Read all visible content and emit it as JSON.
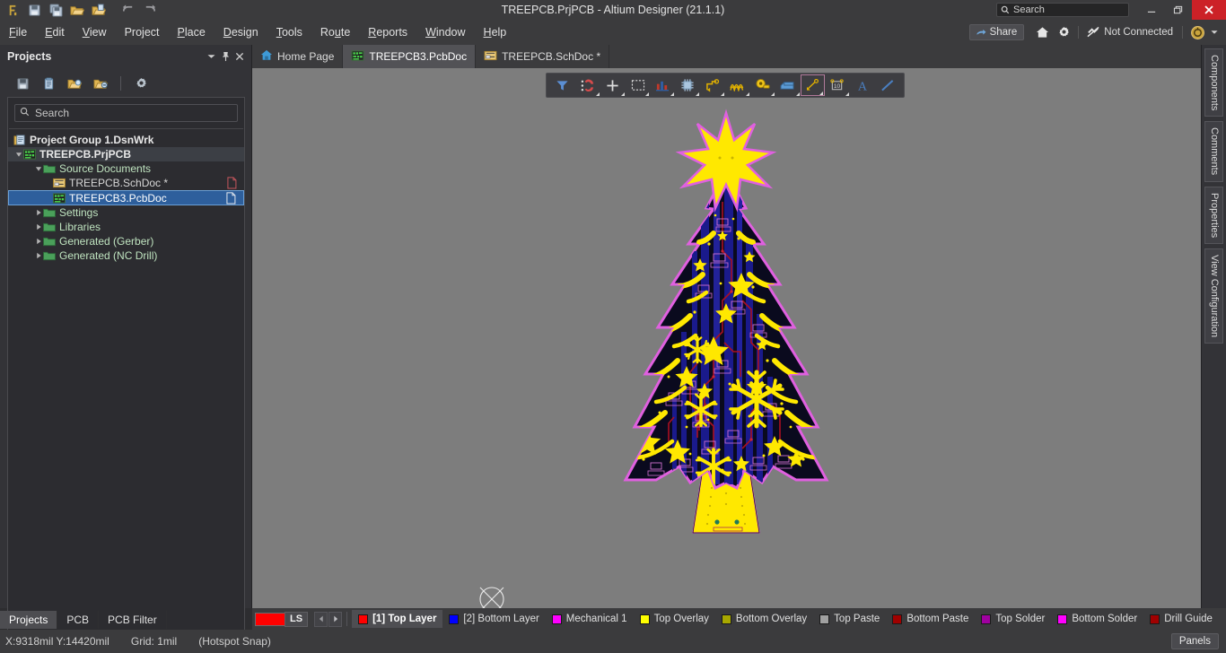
{
  "window": {
    "title": "TREEPCB.PrjPCB - Altium Designer (21.1.1)",
    "search_placeholder": "Search",
    "minimize_label": "_",
    "maximize_label": "❐",
    "close_label": "✕",
    "quick_access": [
      {
        "name": "altium-logo-icon",
        "label": "Altium"
      },
      {
        "name": "save-icon",
        "label": "Save"
      },
      {
        "name": "save-all-icon",
        "label": "Save All"
      },
      {
        "name": "open-icon",
        "label": "Open"
      },
      {
        "name": "open-project-icon",
        "label": "Open Project"
      },
      {
        "name": "undo-icon",
        "label": "Undo"
      },
      {
        "name": "redo-icon",
        "label": "Redo"
      }
    ]
  },
  "menubar": {
    "items": [
      {
        "label": "File",
        "accel": "F"
      },
      {
        "label": "Edit",
        "accel": "E"
      },
      {
        "label": "View",
        "accel": "V"
      },
      {
        "label": "Project",
        "accel": "j"
      },
      {
        "label": "Place",
        "accel": "P"
      },
      {
        "label": "Design",
        "accel": "D"
      },
      {
        "label": "Tools",
        "accel": "T"
      },
      {
        "label": "Route",
        "accel": "u"
      },
      {
        "label": "Reports",
        "accel": "R"
      },
      {
        "label": "Window",
        "accel": "W"
      },
      {
        "label": "Help",
        "accel": "H"
      }
    ],
    "share_label": "Share",
    "home_icon": "home-icon",
    "settings_icon": "gear-icon",
    "connection_status": "Not Connected",
    "account_icon": "account-icon"
  },
  "projects_panel": {
    "title": "Projects",
    "header_buttons": [
      "chevron-down-icon",
      "pin-icon",
      "close-icon"
    ],
    "toolbar_icons": [
      "save-project-icon",
      "compile-icon",
      "open-project-icon",
      "close-project-icon",
      "project-options-icon"
    ],
    "search_placeholder": "Search",
    "tree": [
      {
        "label": "Project Group 1.DsnWrk",
        "level": 0,
        "icon": "workspace-icon",
        "bold": true,
        "expander": "none",
        "state": "normal"
      },
      {
        "label": "TREEPCB.PrjPCB",
        "level": 1,
        "icon": "pcb-project-icon",
        "bold": true,
        "expander": "expanded",
        "state": "soft-selected"
      },
      {
        "label": "Source Documents",
        "level": 2,
        "icon": "folder-icon",
        "bold": false,
        "expander": "expanded",
        "state": "normal"
      },
      {
        "label": "TREEPCB.SchDoc *",
        "level": 3,
        "icon": "schdoc-icon",
        "bold": false,
        "expander": "none",
        "state": "normal",
        "right_icon": "modified-doc-icon"
      },
      {
        "label": "TREEPCB3.PcbDoc",
        "level": 3,
        "icon": "pcbdoc-icon",
        "bold": false,
        "expander": "none",
        "state": "selected",
        "right_icon": "doc-icon"
      },
      {
        "label": "Settings",
        "level": 2,
        "icon": "folder-icon",
        "bold": false,
        "expander": "collapsed",
        "state": "normal"
      },
      {
        "label": "Libraries",
        "level": 2,
        "icon": "folder-icon",
        "bold": false,
        "expander": "collapsed",
        "state": "normal"
      },
      {
        "label": "Generated (Gerber)",
        "level": 2,
        "icon": "folder-icon",
        "bold": false,
        "expander": "collapsed",
        "state": "normal"
      },
      {
        "label": "Generated (NC Drill)",
        "level": 2,
        "icon": "folder-icon",
        "bold": false,
        "expander": "collapsed",
        "state": "normal"
      }
    ]
  },
  "document_tabs": [
    {
      "label": "Home Page",
      "icon": "home-icon",
      "active": false
    },
    {
      "label": "TREEPCB3.PcbDoc",
      "icon": "pcbdoc-icon",
      "active": true
    },
    {
      "label": "TREEPCB.SchDoc *",
      "icon": "schdoc-icon",
      "active": false
    }
  ],
  "pcb_toolbar": [
    {
      "name": "filter-icon",
      "label": "Filter",
      "dropdown": false,
      "boxed": false
    },
    {
      "name": "magnet-snap-icon",
      "label": "Snapping",
      "dropdown": true,
      "boxed": false
    },
    {
      "name": "crosshair-icon",
      "label": "Placement Modes",
      "dropdown": true,
      "boxed": false
    },
    {
      "name": "selection-box-icon",
      "label": "Selection Area",
      "dropdown": true,
      "boxed": false
    },
    {
      "name": "component-place-icon",
      "label": "Place Component",
      "dropdown": true,
      "boxed": false
    },
    {
      "name": "ic-icon",
      "label": "Place Part",
      "dropdown": true,
      "boxed": false
    },
    {
      "name": "route-track-icon",
      "label": "Interactive Routing",
      "dropdown": true,
      "boxed": false
    },
    {
      "name": "differential-pair-icon",
      "label": "Differential Pair Routing",
      "dropdown": true,
      "boxed": false
    },
    {
      "name": "via-pad-icon",
      "label": "Place Pad",
      "dropdown": true,
      "boxed": false
    },
    {
      "name": "polygon-pour-icon",
      "label": "Place Polygon",
      "dropdown": true,
      "boxed": false
    },
    {
      "name": "dimension-icon",
      "label": "Dimension",
      "dropdown": true,
      "boxed": true
    },
    {
      "name": "measure-icon",
      "label": "Measure",
      "dropdown": true,
      "boxed": false
    },
    {
      "name": "text-icon",
      "label": "Place String",
      "dropdown": false,
      "boxed": false
    },
    {
      "name": "line-icon",
      "label": "Place Line",
      "dropdown": false,
      "boxed": false
    }
  ],
  "right_panel_tabs": [
    {
      "label": "Components"
    },
    {
      "label": "Comments"
    },
    {
      "label": "Properties"
    },
    {
      "label": "View Configuration"
    }
  ],
  "layer_bar": {
    "ls_label": "LS",
    "ls_color": "#ff0000",
    "prev_label": "◀",
    "next_label": "▶",
    "layers": [
      {
        "label": "[1] Top Layer",
        "color": "#ff0000",
        "active": true
      },
      {
        "label": "[2] Bottom Layer",
        "color": "#0000ff",
        "active": false
      },
      {
        "label": "Mechanical 1",
        "color": "#ff00ff",
        "active": false
      },
      {
        "label": "Top Overlay",
        "color": "#ffff00",
        "active": false
      },
      {
        "label": "Bottom Overlay",
        "color": "#a8a800",
        "active": false
      },
      {
        "label": "Top Paste",
        "color": "#a0a0a0",
        "active": false
      },
      {
        "label": "Bottom Paste",
        "color": "#a00000",
        "active": false
      },
      {
        "label": "Top Solder",
        "color": "#a000a0",
        "active": false
      },
      {
        "label": "Bottom Solder",
        "color": "#ff00ff",
        "active": false
      },
      {
        "label": "Drill Guide",
        "color": "#a00000",
        "active": false
      }
    ]
  },
  "bottom_panel_tabs": [
    {
      "label": "Projects",
      "active": true
    },
    {
      "label": "PCB",
      "active": false
    },
    {
      "label": "PCB Filter",
      "active": false
    }
  ],
  "statusbar": {
    "coordinates": "X:9318mil Y:14420mil",
    "grid": "Grid: 1mil",
    "snap_mode": "(Hotspot Snap)",
    "panels_label": "Panels"
  },
  "canvas": {
    "background_color": "#7d7d7d",
    "artwork_name": "christmas-tree-pcb",
    "origin_marker": "origin-crosshair-icon"
  }
}
